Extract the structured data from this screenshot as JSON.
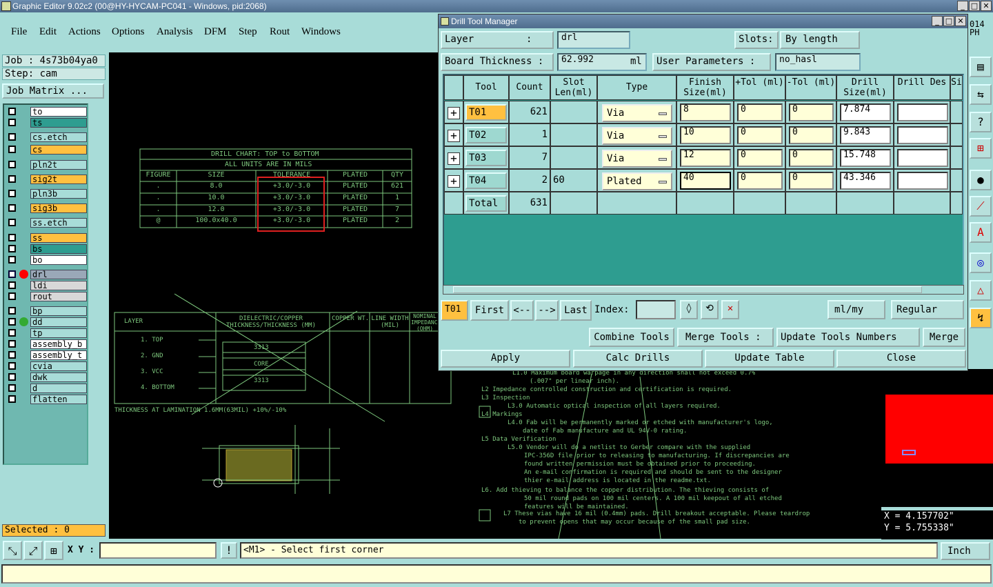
{
  "app": {
    "title": "Graphic Editor 9.02c2 (00@HY-HYCAM-PC041 - Windows, pid:2068)",
    "right_edge_text_1": "014",
    "right_edge_text_2": "PH"
  },
  "menu": [
    "File",
    "Edit",
    "Actions",
    "Options",
    "Analysis",
    "DFM",
    "Step",
    "Rout",
    "Windows"
  ],
  "job": {
    "job": "Job : 4s73b04ya0",
    "step": "Step: cam",
    "matrix_label": "Job Matrix ..."
  },
  "layers": [
    {
      "name": "to",
      "color": "#ffffff"
    },
    {
      "name": "ts",
      "color": "#2e9d90"
    },
    {
      "name": "cs.etch",
      "color": "#a8dcd8"
    },
    {
      "name": "cs",
      "color": "#ffc040"
    },
    {
      "name": "pln2t",
      "color": "#a8dcd8"
    },
    {
      "name": "sig2t",
      "color": "#ffc040"
    },
    {
      "name": "pln3b",
      "color": "#a8dcd8"
    },
    {
      "name": "sig3b",
      "color": "#ffc040"
    },
    {
      "name": "ss.etch",
      "color": "#a8dcd8"
    },
    {
      "name": "ss",
      "color": "#ffc040"
    },
    {
      "name": "bs",
      "color": "#2e9d90"
    },
    {
      "name": "bo",
      "color": "#ffffff"
    },
    {
      "name": "drl",
      "color": "#9aa8b8"
    },
    {
      "name": "ldi",
      "color": "#d8d8d8"
    },
    {
      "name": "rout",
      "color": "#d8d8d8"
    },
    {
      "name": "bp",
      "color": "#a8dcd8"
    },
    {
      "name": "dd",
      "color": "#a8dcd8"
    },
    {
      "name": "tp",
      "color": "#a8dcd8"
    },
    {
      "name": "assembly_b",
      "color": "#ffffff"
    },
    {
      "name": "assembly_t",
      "color": "#ffffff"
    },
    {
      "name": "cvia",
      "color": "#a8dcd8"
    },
    {
      "name": "dwk",
      "color": "#a8dcd8"
    },
    {
      "name": "d",
      "color": "#a8dcd8"
    },
    {
      "name": "flatten",
      "color": "#a8dcd8"
    }
  ],
  "selected": "Selected : 0",
  "drill_chart": {
    "title1": "DRILL CHART: TOP to BOTTOM",
    "title2": "ALL UNITS ARE IN MILS",
    "headers": [
      "FIGURE",
      "SIZE",
      "TOLERANCE",
      "PLATED",
      "QTY"
    ],
    "rows": [
      [
        ".",
        "8.0",
        "+3.0/-3.0",
        "PLATED",
        "621"
      ],
      [
        ".",
        "10.0",
        "+3.0/-3.0",
        "PLATED",
        "1"
      ],
      [
        ".",
        "12.0",
        "+3.0/-3.0",
        "PLATED",
        "7"
      ],
      [
        "@",
        "100.0x40.0",
        "+3.0/-3.0",
        "PLATED",
        "2"
      ]
    ]
  },
  "stackup": {
    "layer_hdr": "LAYER",
    "diel_hdr": "DIELECTRIC/COPPER THICKNESS/THICKNESS (MM)",
    "cu_hdr": "COPPER WT.",
    "lw_hdr": "LINE WIDTH (MIL)",
    "imp_hdr": "NOMINAL IMPEDANCE (OHM)",
    "layers": [
      "1. TOP",
      "2. GND",
      "3. VCC",
      "4. BOTTOM"
    ],
    "core": [
      "3313",
      "CORE",
      "3313"
    ],
    "footer": "THICKNESS AT LAMINATION 1.6MM(63MIL) +10%/-10%"
  },
  "notes": [
    "L1.0 Maximum board warpage in any direction shall not exceed 0.7%",
    "(.007\" per linear inch).",
    "L2   Impedance controlled construction and certification is required.",
    "L3   Inspection",
    "L3.0 Automatic optical inspection of all layers required.",
    "L4   Markings",
    "L4.0 Fab will be permanently marked or etched with manufacturer's logo,",
    "date of Fab manufacture and UL 94V-0 rating.",
    "L5   Data Verification",
    "L5.0 Vendor will do a netlist to Gerber compare with the supplied",
    "IPC-356D file prior to releasing to manufacturing.  If discrepancies are",
    "found written permission must be obtained prior to proceeding.",
    "An e-mail confirmation is required and should be sent to the designer",
    "thier e-mail address is located in the readme.txt.",
    "L6.  Add thieving to balance the copper distribution. The thieving consists of",
    "50 mil round pads on 100 mil centers.  A 100 mil keepout of all etched",
    "features will be maintained.",
    "L7   These vias have 16 mil (0.4mm) pads. Drill breakout acceptable. Please teardrop",
    "to prevent opens that may occur because of the small pad size."
  ],
  "coords": {
    "x": "X = 4.157702\"",
    "y": "Y = 5.755338\""
  },
  "status": {
    "xy_label": "X Y :",
    "xy_value": "",
    "prompt": "<M1> - Select first corner",
    "units": "Inch"
  },
  "dialog": {
    "title": "Drill Tool Manager",
    "layer_label": "Layer         :",
    "layer_value": "drl",
    "slots_label": "Slots:",
    "slots_value": "By length",
    "board_thickness_label": "Board Thickness :",
    "board_thickness_value": "62.992",
    "board_thickness_unit": "ml",
    "user_params_label": "User Parameters :",
    "user_params_value": "no_hasl",
    "columns": [
      "Tool",
      "Count",
      "Slot Len(ml)",
      "Type",
      "Finish Size(ml)",
      "+Tol (ml)",
      "-Tol (ml)",
      "Drill Size(ml)",
      "Drill Des",
      "Si"
    ],
    "rows": [
      {
        "tool": "T01",
        "count": "621",
        "slot": "",
        "type": "Via",
        "finish": "8",
        "ptol": "0",
        "mtol": "0",
        "drill": "7.874",
        "des": ""
      },
      {
        "tool": "T02",
        "count": "1",
        "slot": "",
        "type": "Via",
        "finish": "10",
        "ptol": "0",
        "mtol": "0",
        "drill": "9.843",
        "des": ""
      },
      {
        "tool": "T03",
        "count": "7",
        "slot": "",
        "type": "Via",
        "finish": "12",
        "ptol": "0",
        "mtol": "0",
        "drill": "15.748",
        "des": ""
      },
      {
        "tool": "T04",
        "count": "2",
        "slot": "60",
        "type": "Plated",
        "finish": "40",
        "ptol": "0",
        "mtol": "0",
        "drill": "43.346",
        "des": ""
      }
    ],
    "total_label": "Total",
    "total_count": "631",
    "current_tool": "T01",
    "nav": {
      "first": "First",
      "prev": "<--",
      "next": "-->",
      "last": "Last",
      "index_label": "Index:",
      "index_value": ""
    },
    "units_value": "ml/my",
    "mode_value": "Regular",
    "combine_tools": "Combine Tools",
    "merge_tools_label": "Merge Tools :",
    "merge_select": "Update Tools Numbers",
    "merge_btn": "Merge",
    "apply": "Apply",
    "calc": "Calc Drills",
    "update": "Update Table",
    "close": "Close"
  },
  "colors": {
    "panel": "#a8dcd8",
    "table_bg": "#2e9d90",
    "yellow_field": "#ffffd8",
    "orange_tool": "#ffc040",
    "drawing": "#7ec87e",
    "annotation_red": "#e02020"
  }
}
